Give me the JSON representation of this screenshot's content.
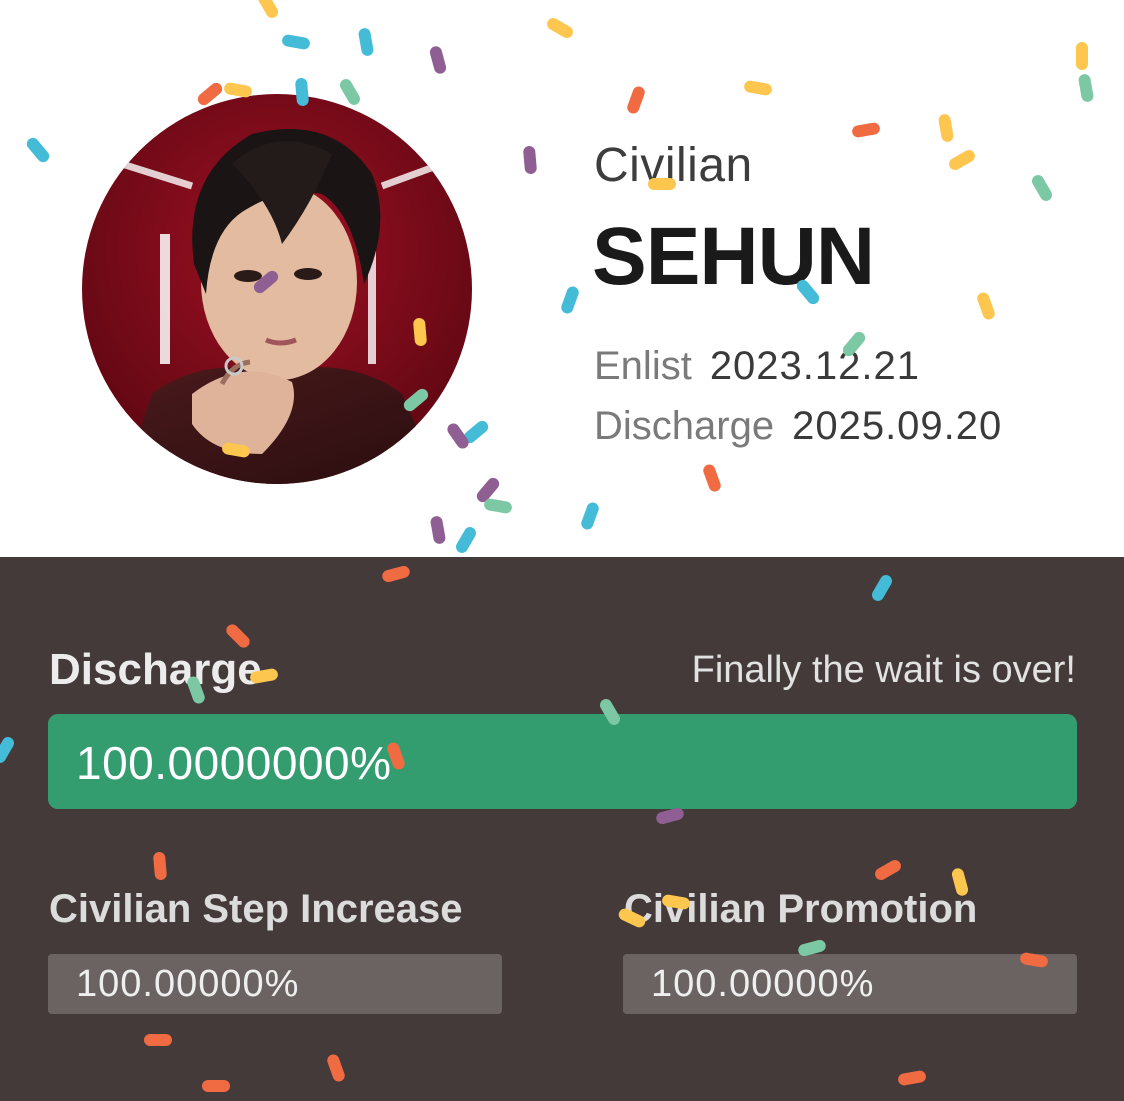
{
  "profile": {
    "status": "Civilian",
    "name": "SEHUN",
    "enlist_label": "Enlist",
    "enlist_date": "2023.12.21",
    "discharge_label": "Discharge",
    "discharge_date": "2025.09.20"
  },
  "progress": {
    "title": "Discharge",
    "message": "Finally the wait is over!",
    "main_value": "100.0000000%",
    "main_fraction": 1.0,
    "fill_color": "#349d70",
    "step_increase": {
      "label": "Civilian Step Increase",
      "value": "100.00000%",
      "fraction": 1.0
    },
    "promotion": {
      "label": "Civilian Promotion",
      "value": "100.00000%",
      "fraction": 1.0
    }
  },
  "theme": {
    "background_top": "#ffffff",
    "background_bottom": "#443a3a",
    "confetti_colors": [
      "#f06a42",
      "#fdc64e",
      "#44bcd8",
      "#7cc8a4",
      "#8f5f93"
    ]
  }
}
